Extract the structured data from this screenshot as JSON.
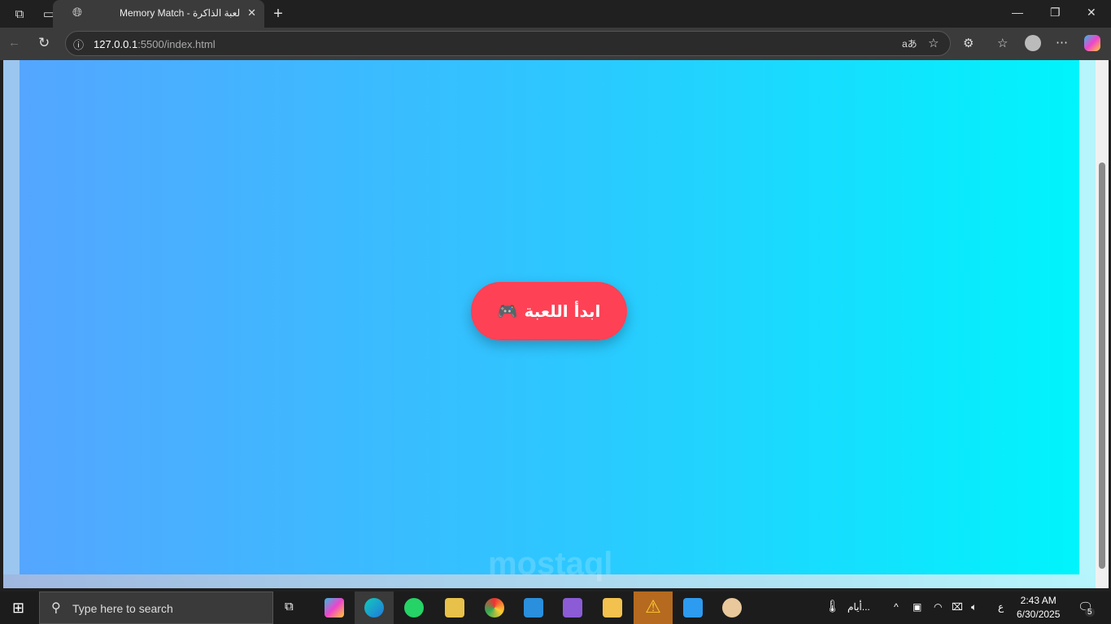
{
  "browser": {
    "tab_title": "Memory Match - لعبة الذاكرة",
    "url_host": "127.0.0.1",
    "url_rest": ":5500/index.html"
  },
  "page": {
    "start_button": "ابدأ اللعبة",
    "start_icon": "🎮"
  },
  "taskbar": {
    "search_placeholder": "Type here to search",
    "weather": "أيام...",
    "lang": "ع",
    "time": "2:43 AM",
    "date": "6/30/2025",
    "notifications": "5"
  }
}
